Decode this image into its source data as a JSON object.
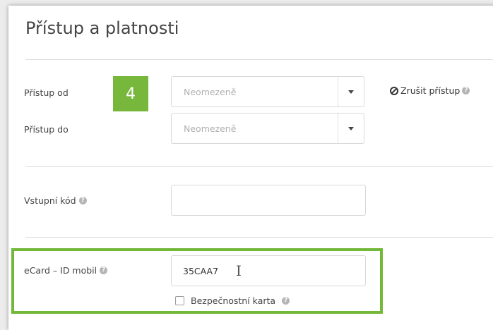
{
  "section": {
    "title": "Přístup a platnosti"
  },
  "access": {
    "from_label": "Přístup od",
    "to_label": "Přístup do",
    "from_value": "Neomezeně",
    "to_value": "Neomezeně",
    "revoke_label": "Zrušit přístup",
    "step_number": "4"
  },
  "entry_code": {
    "label": "Vstupní kód",
    "value": ""
  },
  "ecard": {
    "label": "eCard – ID mobil",
    "value": "35CAA7",
    "secure_card_label": "Bezpečnostní karta",
    "secure_card_checked": false
  },
  "colors": {
    "accent_green": "#77b73c"
  },
  "icons": [
    "help-icon",
    "ban-icon",
    "chevron-down-icon",
    "text-cursor-icon"
  ]
}
